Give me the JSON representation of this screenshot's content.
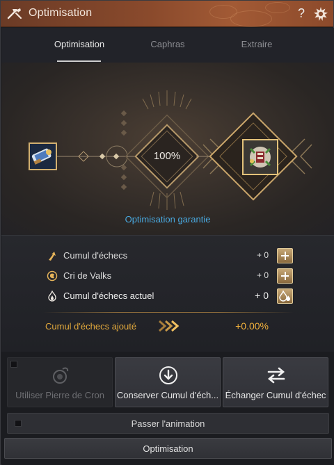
{
  "window": {
    "title": "Optimisation"
  },
  "tabs": [
    {
      "label": "Optimisation",
      "active": true
    },
    {
      "label": "Caphras",
      "active": false
    },
    {
      "label": "Extraire",
      "active": false
    }
  ],
  "stage": {
    "chance": "100%",
    "guarantee_text": "Optimisation garantie"
  },
  "stats": {
    "rows": [
      {
        "label": "Cumul d'échecs",
        "value": "+ 0",
        "icon": "arrow-up-icon"
      },
      {
        "label": "Cri de Valks",
        "value": "+ 0",
        "icon": "valks-icon"
      },
      {
        "label": "Cumul d'échecs actuel",
        "value": "+ 0",
        "icon": "flame-icon"
      }
    ],
    "added_label": "Cumul d'échecs ajouté",
    "added_value": "+0.00%"
  },
  "actions": {
    "cron_label": "Utiliser Pierre de Cron",
    "keep_label": "Conserver Cumul d'éch...",
    "swap_label": "Échanger Cumul d'échec",
    "skip_label": "Passer l'animation",
    "main_label": "Optimisation"
  },
  "colors": {
    "title_bar": "#8a4a2c",
    "accent_gold": "#e3a93c",
    "guarantee_blue": "#49a9e0"
  }
}
